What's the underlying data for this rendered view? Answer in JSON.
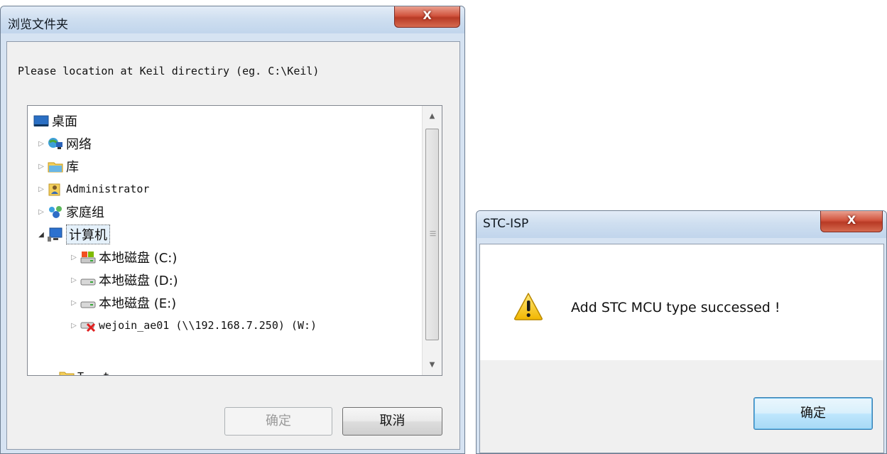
{
  "browse_dialog": {
    "title": "浏览文件夹",
    "close_label": "X",
    "prompt": "Please location at Keil directiry (eg. C:\\Keil)",
    "tree": [
      {
        "label": "桌面",
        "icon": "desktop-icon",
        "arrow": ""
      },
      {
        "label": "网络",
        "icon": "network-icon",
        "arrow": "▷"
      },
      {
        "label": "库",
        "icon": "library-icon",
        "arrow": "▷"
      },
      {
        "label": "Administrator",
        "icon": "user-folder-icon",
        "arrow": "▷"
      },
      {
        "label": "家庭组",
        "icon": "homegroup-icon",
        "arrow": "▷"
      },
      {
        "label": "计算机",
        "icon": "computer-icon",
        "arrow": "◢",
        "selected": true
      },
      {
        "label": "本地磁盘 (C:)",
        "icon": "system-drive-icon",
        "arrow": "▷"
      },
      {
        "label": "本地磁盘 (D:)",
        "icon": "drive-icon",
        "arrow": "▷"
      },
      {
        "label": "本地磁盘 (E:)",
        "icon": "drive-icon",
        "arrow": "▷"
      },
      {
        "label": "wejoin_ae01 (\\\\192.168.7.250) (W:)",
        "icon": "disconnected-network-drive-icon",
        "arrow": "▷"
      },
      {
        "label": "T---t",
        "icon": "folder-icon",
        "arrow": ""
      }
    ],
    "ok_label": "确定",
    "cancel_label": "取消"
  },
  "message_dialog": {
    "title": "STC-ISP",
    "close_label": "X",
    "message": "Add STC MCU type successed !",
    "icon": "warning-icon",
    "ok_label": "确定"
  },
  "colors": {
    "titlebar": "#cfdff0",
    "close_button": "#c8452d",
    "selection": "#e5f1fb",
    "default_button": "#3c7fb1",
    "warning": "#f5c400"
  }
}
